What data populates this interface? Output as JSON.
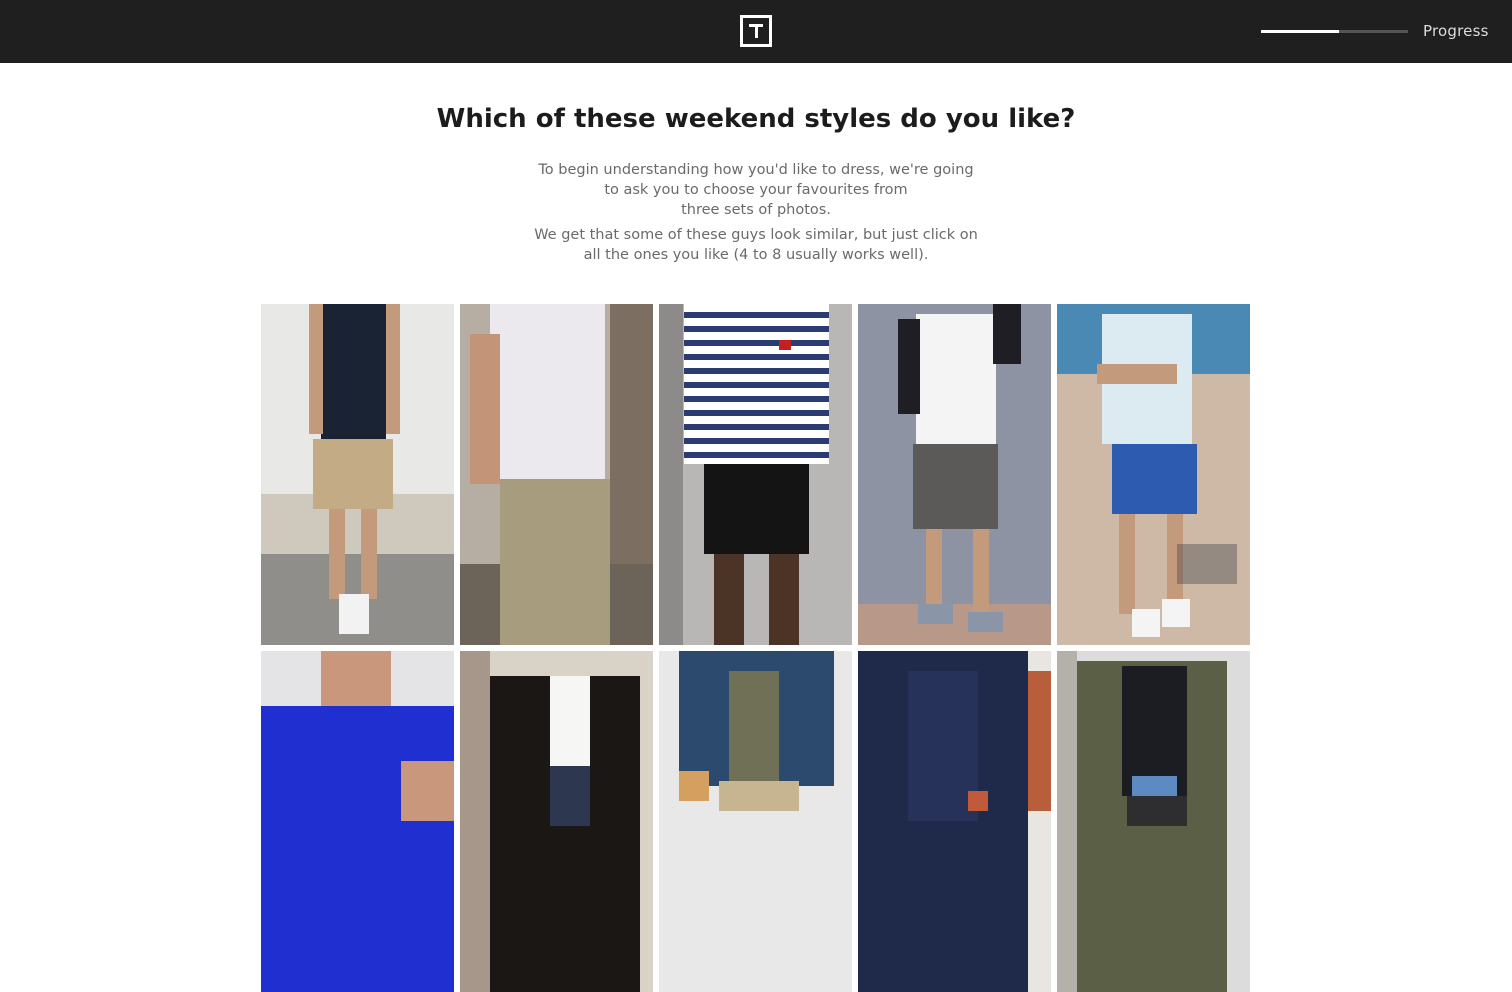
{
  "header": {
    "logo_icon": "T-logo-icon",
    "progress": {
      "label": "Progress",
      "fraction": 0.53
    }
  },
  "question": {
    "title": "Which of these weekend styles do you like?",
    "intro_lines": [
      "To begin understanding how you'd like to dress, we're going",
      "to ask you to choose your favourites from",
      "three sets of photos."
    ],
    "hint_lines": [
      "We get that some of these guys look similar, but just click on",
      "all the ones you like (4 to 8 usually works well)."
    ]
  },
  "colors": {
    "header_bg": "#1f1f1f",
    "accent": "#ffffff"
  }
}
